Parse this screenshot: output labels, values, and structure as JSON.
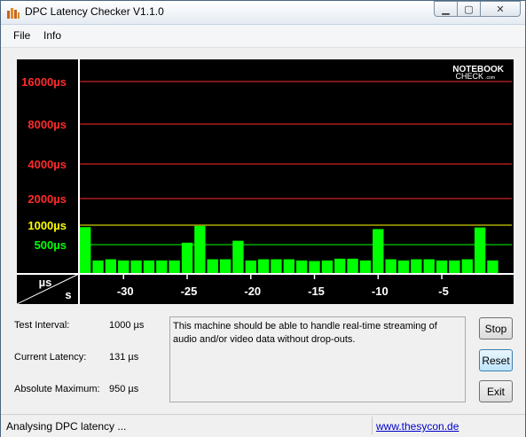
{
  "window": {
    "title": "DPC Latency Checker V1.1.0"
  },
  "menu": {
    "file": "File",
    "info": "Info"
  },
  "chart_data": {
    "type": "bar",
    "title": "",
    "logo_line1": "NOTEBOOK",
    "logo_line2": "CHECK",
    "logo_suffix": ".com",
    "y_unit_label": "µs",
    "x_unit_label": "s",
    "y_gridlines": [
      {
        "label": "16000µs",
        "color": "#ff2a2a"
      },
      {
        "label": "8000µs",
        "color": "#ff2a2a"
      },
      {
        "label": "4000µs",
        "color": "#ff2a2a"
      },
      {
        "label": "2000µs",
        "color": "#ff2a2a"
      },
      {
        "label": "1000µs",
        "color": "#ffff00"
      },
      {
        "label": "500µs",
        "color": "#00ff00"
      }
    ],
    "x_ticks": [
      "-30",
      "-25",
      "-20",
      "-15",
      "-10",
      "-5"
    ],
    "xlim": [
      -34,
      0
    ],
    "bar_color": "#00ff00",
    "background_color": "#000000",
    "x": [
      -33,
      -32,
      -31,
      -30,
      -29,
      -28,
      -27,
      -26,
      -25,
      -24,
      -23,
      -22,
      -21,
      -20,
      -19,
      -18,
      -17,
      -16,
      -15,
      -14,
      -13,
      -12,
      -11,
      -10,
      -9,
      -8,
      -7,
      -6,
      -5,
      -4,
      -3,
      -2,
      -1
    ],
    "values": [
      950,
      230,
      250,
      230,
      230,
      230,
      230,
      230,
      550,
      980,
      250,
      250,
      600,
      230,
      250,
      250,
      250,
      230,
      220,
      230,
      260,
      260,
      230,
      900,
      250,
      230,
      250,
      250,
      230,
      230,
      250,
      940,
      230
    ]
  },
  "info": {
    "test_interval_label": "Test Interval:",
    "test_interval_value": "1000 µs",
    "current_latency_label": "Current Latency:",
    "current_latency_value": "131 µs",
    "absolute_maximum_label": "Absolute Maximum:",
    "absolute_maximum_value": "950 µs"
  },
  "message": "This machine should be able to handle real-time streaming of audio and/or video data without drop-outs.",
  "buttons": {
    "stop": "Stop",
    "reset": "Reset",
    "exit": "Exit"
  },
  "status": {
    "text": "Analysing DPC latency ...",
    "link": "www.thesycon.de"
  }
}
